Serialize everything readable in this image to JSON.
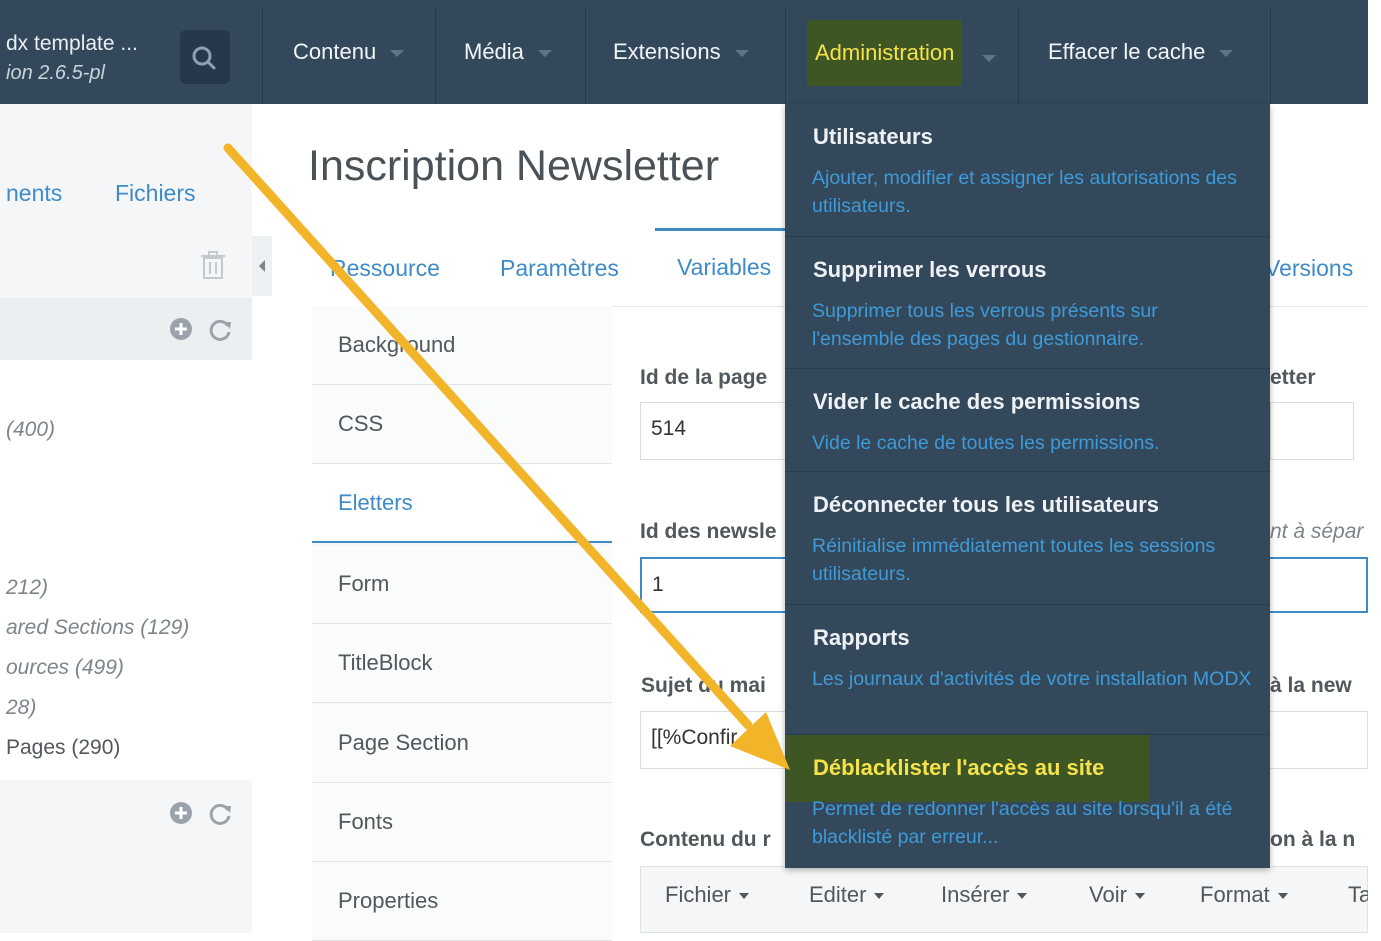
{
  "header": {
    "site_title": "dx template ...",
    "site_version": "ion 2.6.5-pl",
    "nav": [
      {
        "label": "Contenu"
      },
      {
        "label": "Média"
      },
      {
        "label": "Extensions"
      },
      {
        "label": "Administration"
      },
      {
        "label": "Effacer le cache"
      }
    ]
  },
  "tree": {
    "tabs": [
      {
        "label": "nents"
      },
      {
        "label": "Fichiers"
      }
    ],
    "rows": [
      {
        "label": "(400)"
      },
      {
        "label": "212)"
      },
      {
        "label": "ared Sections (129)"
      },
      {
        "label": "ources (499)"
      },
      {
        "label": "28)"
      },
      {
        "label": "Pages (290)"
      }
    ]
  },
  "main": {
    "title": "Inscription Newsletter",
    "tabs": [
      {
        "label": "Ressource"
      },
      {
        "label": "Paramètres"
      },
      {
        "label": "Variables"
      },
      {
        "label": "Versions"
      }
    ],
    "vtabs": [
      {
        "label": "Background"
      },
      {
        "label": "CSS"
      },
      {
        "label": "Eletters"
      },
      {
        "label": "Form"
      },
      {
        "label": "TitleBlock"
      },
      {
        "label": "Page Section"
      },
      {
        "label": "Fonts"
      },
      {
        "label": "Properties"
      }
    ],
    "fields": {
      "page_id_label": "Id de la page",
      "page_id_value": "514",
      "newsletter_label_right": "etter",
      "newsletter_ids_label": "Id des newsle",
      "newsletter_ids_value": "1",
      "hint_right": "nt à sépar",
      "subject_label": "Sujet du mai",
      "subject_value": "[[%Confir",
      "subject_right": "à la new",
      "content_label": "Contenu du r",
      "content_right": "on à la n"
    },
    "editor_menus": [
      {
        "label": "Fichier"
      },
      {
        "label": "Editer"
      },
      {
        "label": "Insérer"
      },
      {
        "label": "Voir"
      },
      {
        "label": "Format"
      },
      {
        "label": "Ta"
      }
    ]
  },
  "dropdown": {
    "items": [
      {
        "title": "Utilisateurs",
        "desc": "Ajouter, modifier et assigner les autorisations des utilisateurs."
      },
      {
        "title": "Supprimer les verrous",
        "desc": "Supprimer tous les verrous présents sur l'ensemble des pages du gestionnaire."
      },
      {
        "title": "Vider le cache des permissions",
        "desc": "Vide le cache de toutes les permissions."
      },
      {
        "title": "Déconnecter tous les utilisateurs",
        "desc": "Réinitialise immédiatement toutes les sessions utilisateurs."
      },
      {
        "title": "Rapports",
        "desc": "Les journaux d'activités de votre installation MODX"
      },
      {
        "title": "Déblacklister l'accès au site",
        "desc": "Permet de redonner l'accès au site lorsqu'il a été blacklisté par erreur..."
      }
    ]
  },
  "colors": {
    "header_bg": "#33495b",
    "highlight_bg": "#3e5624",
    "highlight_text": "#f6e24c",
    "link": "#3f8bc8",
    "arrow": "#f2b52a"
  }
}
